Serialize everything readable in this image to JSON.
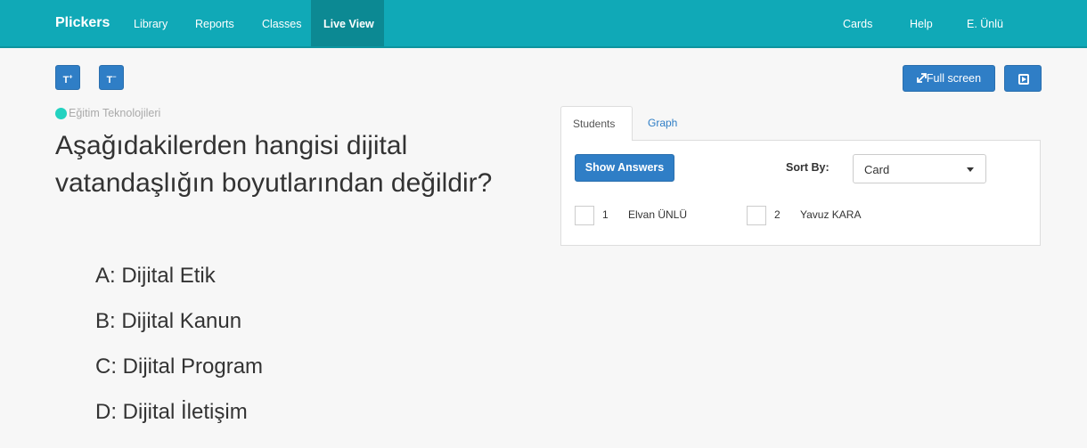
{
  "navbar": {
    "brand": "Plickers",
    "links": [
      "Library",
      "Reports",
      "Classes"
    ],
    "active": "Live View",
    "right": [
      "Cards",
      "Help",
      "E. Ünlü"
    ]
  },
  "toolbar": {
    "increase_font_label": "T",
    "increase_font_sup": "+",
    "decrease_font_label": "T",
    "decrease_font_sup": "−",
    "fullscreen_label": "Full screen"
  },
  "question": {
    "class_name": "Eğitim Teknolojileri",
    "class_color": "#23d2c0",
    "text": "Aşağıdakilerden hangisi dijital vatandaşlığın boyutlarından değildir?",
    "answers": [
      "A:  Dijital Etik",
      "B:  Dijital Kanun",
      "C:  Dijital Program",
      "D:  Dijital İletişim"
    ]
  },
  "panel": {
    "tabs": [
      "Students",
      "Graph"
    ],
    "show_answers_label": "Show Answers",
    "sort_by_label": "Sort By:",
    "sort_value": "Card",
    "students": [
      {
        "num": "1",
        "name": "Elvan ÜNLÜ"
      },
      {
        "num": "2",
        "name": "Yavuz KARA"
      }
    ]
  },
  "colors": {
    "navbar": "#10a9b7",
    "primary_button": "#2f7ec6"
  }
}
